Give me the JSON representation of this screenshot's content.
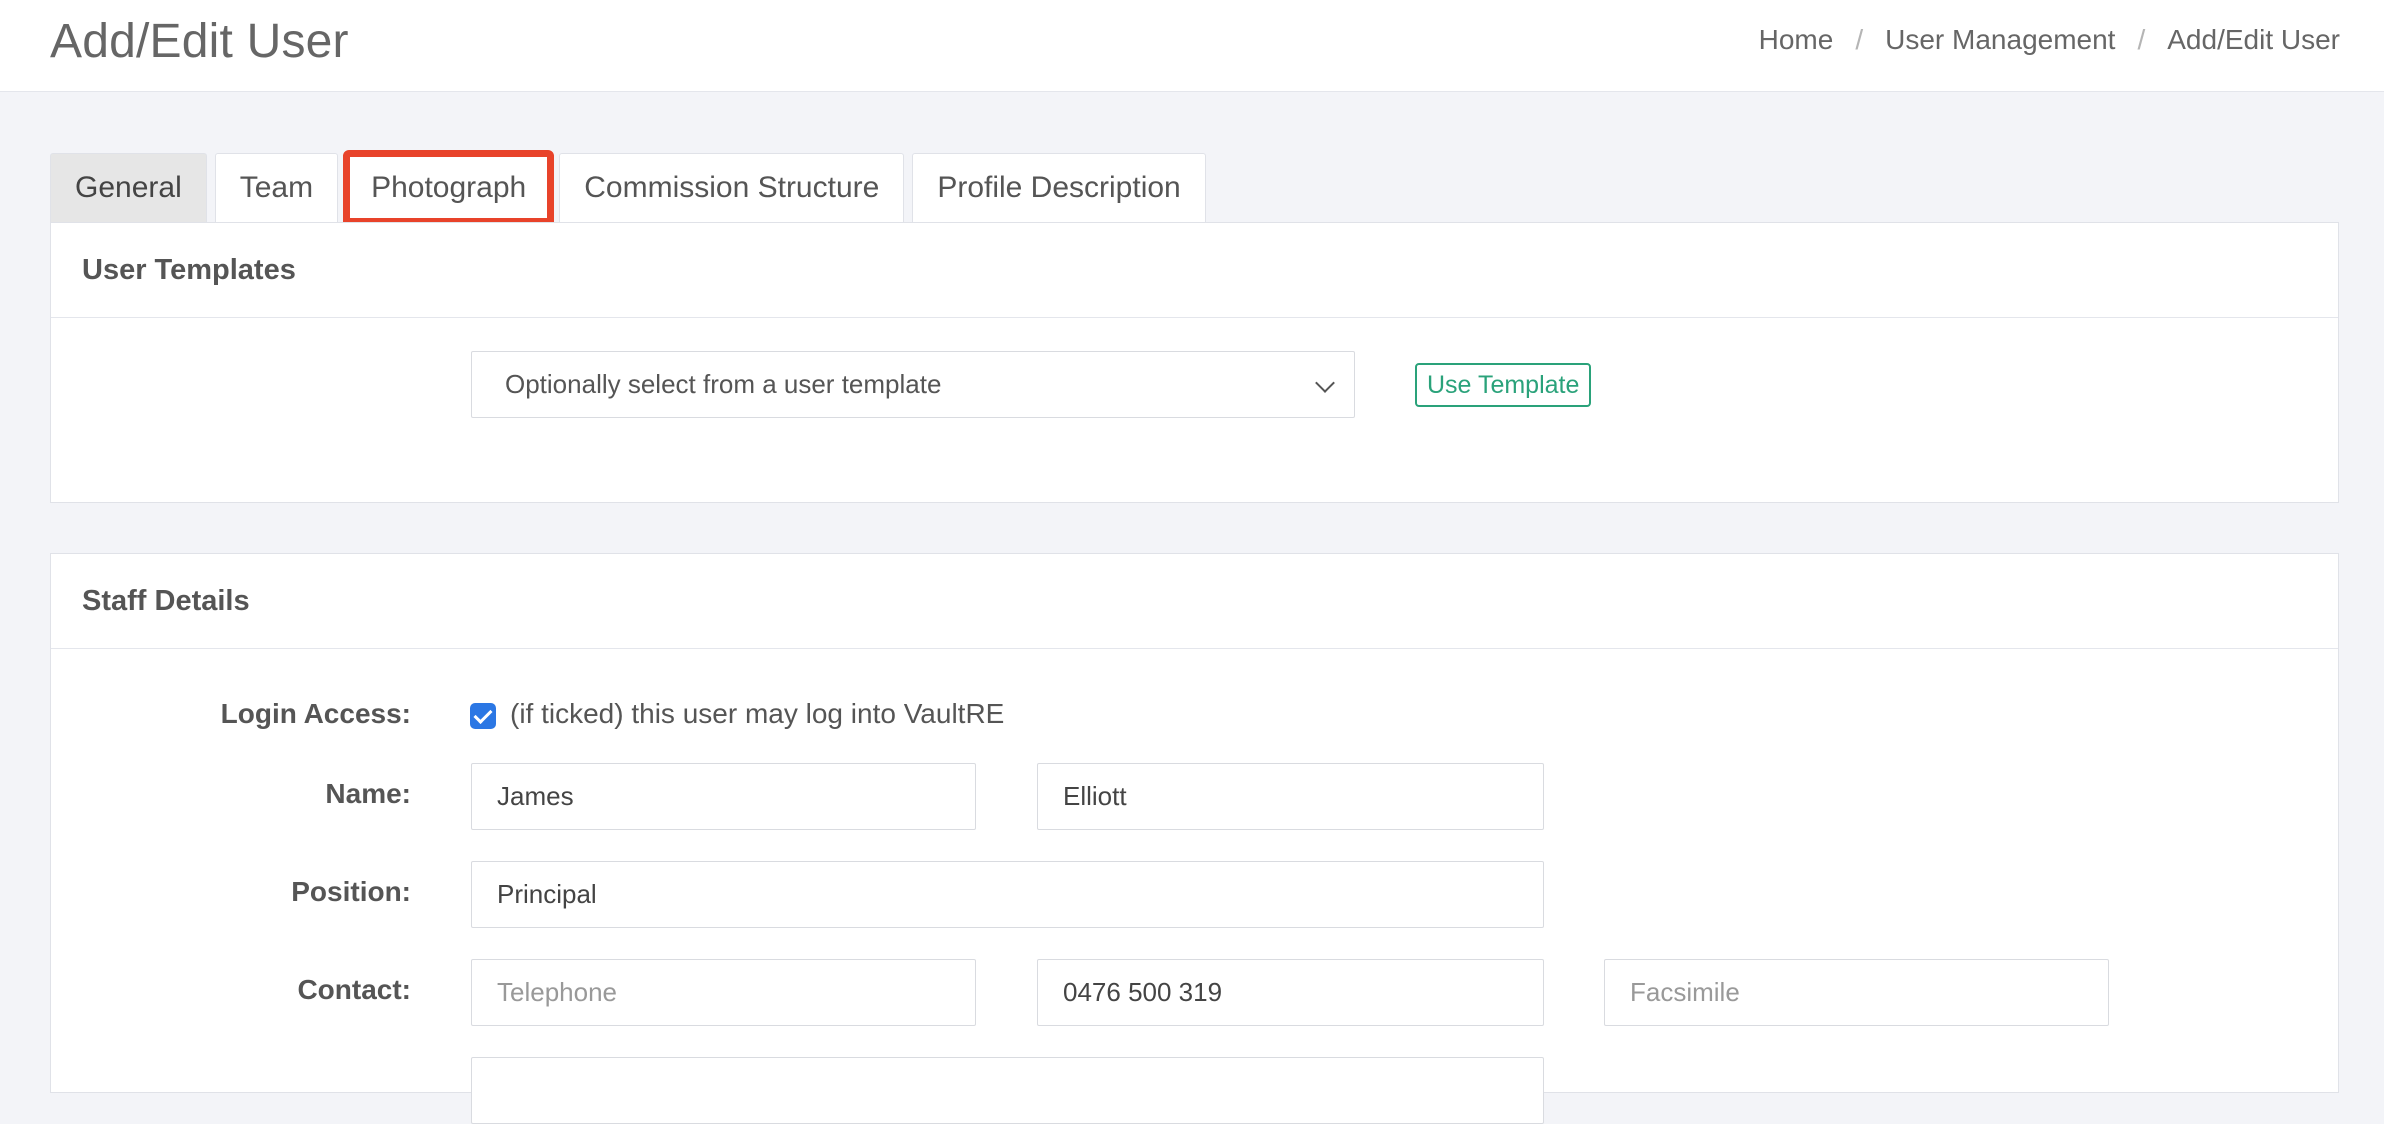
{
  "header": {
    "title": "Add/Edit User",
    "breadcrumb": [
      "Home",
      "User Management",
      "Add/Edit User"
    ],
    "separator": "/"
  },
  "tabs": [
    {
      "label": "General",
      "active": true
    },
    {
      "label": "Team"
    },
    {
      "label": "Photograph",
      "highlighted": true
    },
    {
      "label": "Commission Structure"
    },
    {
      "label": "Profile Description"
    }
  ],
  "templates": {
    "heading": "User Templates",
    "select_value": "Optionally select from a user template",
    "use_button": "Use Template"
  },
  "staff": {
    "heading": "Staff Details",
    "login_label": "Login Access:",
    "login_checked": true,
    "login_text": "(if ticked) this user may log into VaultRE",
    "name_label": "Name:",
    "first_name": "James",
    "last_name": "Elliott",
    "position_label": "Position:",
    "position": "Principal",
    "contact_label": "Contact:",
    "telephone_placeholder": "Telephone",
    "mobile": "0476 500 319",
    "fax_placeholder": "Facsimile"
  },
  "colors": {
    "accent_green": "#2aa27a",
    "highlight_red": "#e8432a",
    "checkbox_blue": "#2b77e4"
  }
}
